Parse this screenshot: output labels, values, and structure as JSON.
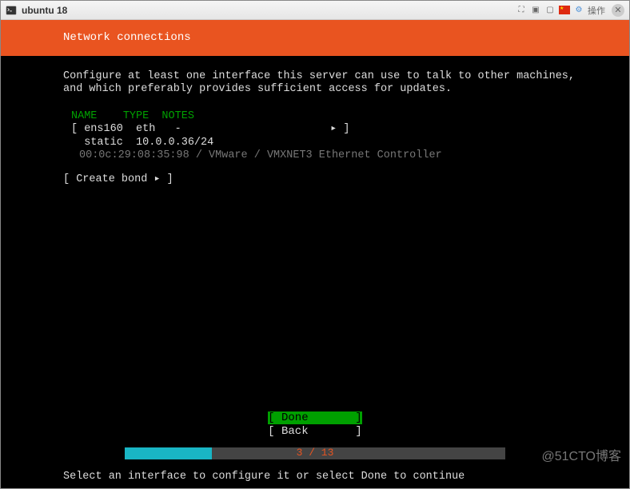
{
  "titlebar": {
    "title": "ubuntu 18",
    "action_label": "操作"
  },
  "installer": {
    "header": "Network connections",
    "description": "Configure at least one interface this server can use to talk to other machines,\nand which preferably provides sufficient access for updates.",
    "columns": {
      "name": "NAME",
      "type": "TYPE",
      "notes": "NOTES"
    },
    "interface": {
      "name": "ens160",
      "type": "eth",
      "notes": "-",
      "mode": "static",
      "address": "10.0.0.36/24",
      "hardware": "00:0c:29:08:35:98 / VMware / VMXNET3 Ethernet Controller"
    },
    "create_bond": "Create bond",
    "buttons": {
      "done": "Done",
      "back": "Back"
    },
    "progress": {
      "current": "3",
      "total": "13",
      "text": "3 / 13"
    },
    "hint": "Select an interface to configure it or select Done to continue"
  },
  "watermark": "@51CTO博客"
}
